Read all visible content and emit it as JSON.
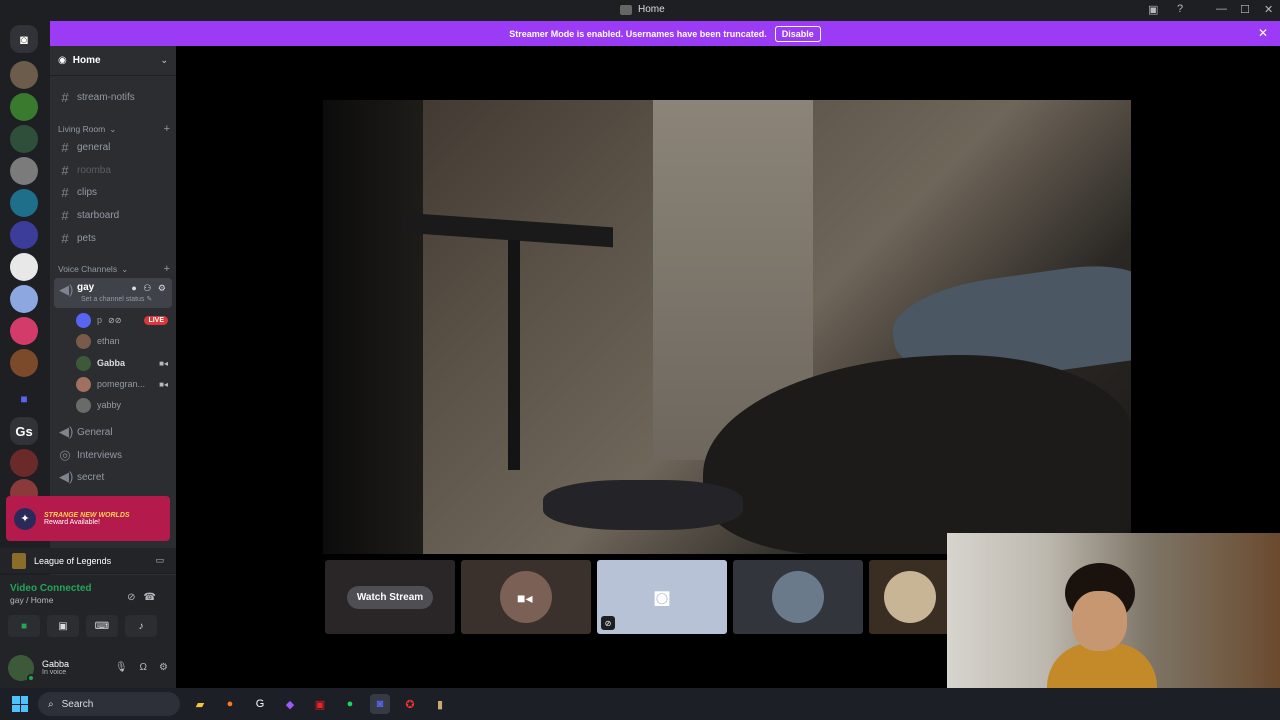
{
  "window": {
    "title": "Home"
  },
  "banner": {
    "text": "Streamer Mode is enabled. Usernames have been truncated.",
    "disable_label": "Disable"
  },
  "servers": {
    "home_glyph": "◙",
    "gs_label": "Gs"
  },
  "channel_list": {
    "header": "Home",
    "top_channel": "stream-notifs",
    "living_room": {
      "label": "Living Room",
      "channels": [
        "general",
        "roomba",
        "clips",
        "starboard",
        "pets"
      ]
    },
    "voice": {
      "label": "Voice Channels",
      "active": {
        "name": "gay",
        "status": "Set a channel status ✎"
      },
      "users": [
        {
          "name": "p",
          "badge": "LIVE"
        },
        {
          "name": "ethan"
        },
        {
          "name": "Gabba"
        },
        {
          "name": "pomegran..."
        },
        {
          "name": "yabby"
        }
      ],
      "others": [
        "General",
        "Interviews",
        "secret"
      ]
    }
  },
  "promo": {
    "title": "STRANGE NEW WORLDS",
    "subtitle": "Reward Available!"
  },
  "game": {
    "name": "League of Legends"
  },
  "voice_connection": {
    "status": "Video Connected",
    "location": "gay / Home"
  },
  "user_panel": {
    "name": "Gabba",
    "status": "In voice"
  },
  "stage": {
    "watch_label": "Watch Stream"
  },
  "taskbar": {
    "search_placeholder": "Search"
  },
  "colors": {
    "banner": "#9b3bf5",
    "connected": "#23a55a",
    "live": "#da373c"
  }
}
